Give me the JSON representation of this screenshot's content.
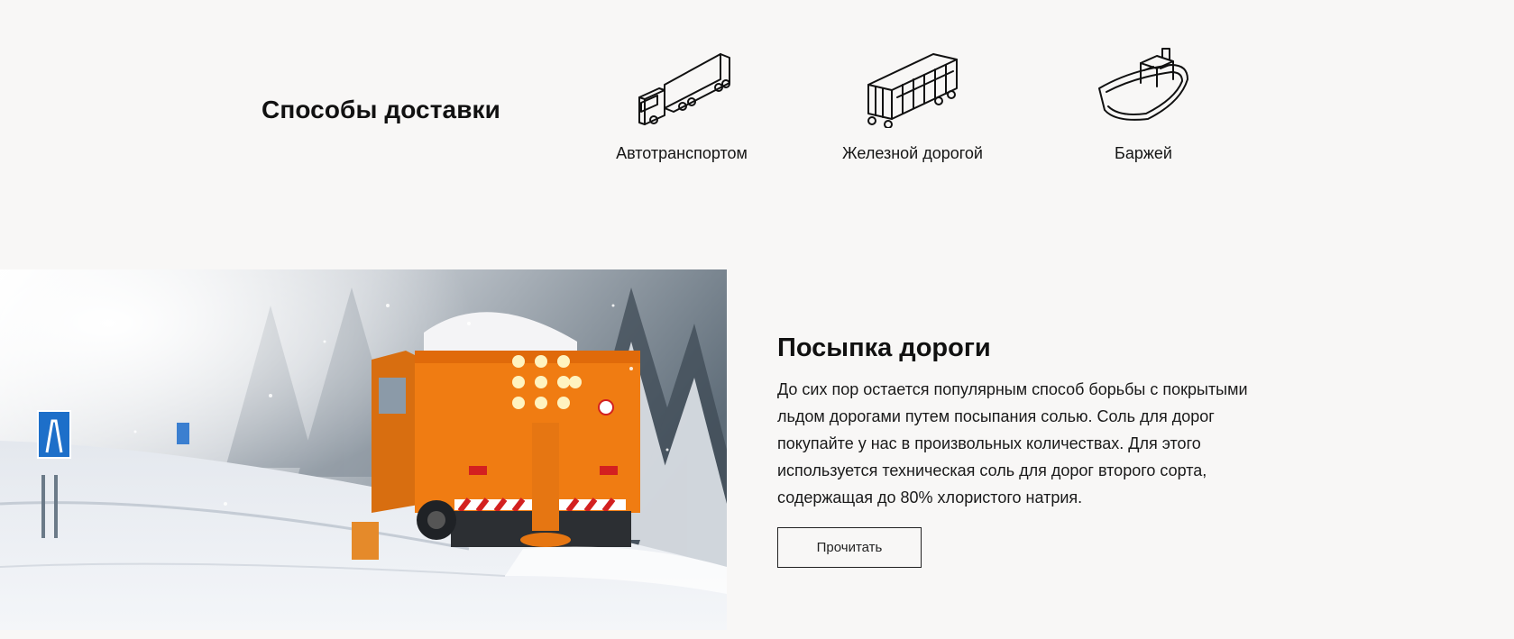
{
  "delivery": {
    "title": "Способы доставки",
    "methods": [
      {
        "icon": "truck-icon",
        "label": "Автотранспортом"
      },
      {
        "icon": "railcar-icon",
        "label": "Железной дорогой"
      },
      {
        "icon": "barge-icon",
        "label": "Баржей"
      }
    ]
  },
  "article": {
    "title": "Посыпка дороги",
    "body": "До сих пор остается популярным способ борьбы с покрытыми льдом дорогами путем посыпания солью. Соль для дорог покупайте у нас в произвольных количествах. Для этого используется техническая соль для дорог второго сорта, содержащая до 80% хлористого натрия.",
    "button_label": "Прочитать"
  },
  "colors": {
    "background": "#f8f7f6",
    "truck_orange": "#f07c12",
    "road_sign_blue": "#1d6fc9"
  }
}
